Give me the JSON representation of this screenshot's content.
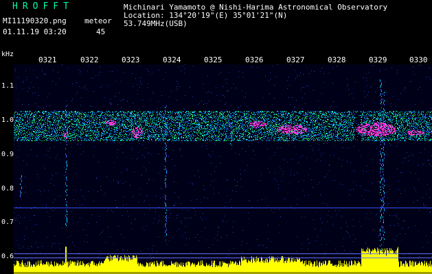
{
  "header": {
    "logo": "HROFFT",
    "filename": "MI11190320.png",
    "datetime": "01.11.19 03:20",
    "label": "meteor",
    "count": "45",
    "author": "Michinari Yamamoto @ Nishi-Harima Astronomical Observatory",
    "location": "Location: 134°20'19\"(E) 35°01'21\"(N)",
    "frequency": "53.749MHz(USB)"
  },
  "axes": {
    "y_unit": "kHz",
    "y_ticks": [
      "1.1",
      "1.0",
      "0.9",
      "0.8",
      "0.7",
      "0.6"
    ],
    "x_ticks": [
      "0321",
      "0322",
      "0323",
      "0324",
      "0325",
      "0326",
      "0327",
      "0328",
      "0329",
      "0330"
    ]
  },
  "colors": {
    "background": "#000000",
    "plot_bg": "#000018",
    "logo": "#00ffaa",
    "text": "#ffffff",
    "cyan": "#00e0ff",
    "green": "#30ff60",
    "magenta": "#ff30d0",
    "yellow": "#ffff00",
    "grid": "#2030a0"
  }
}
